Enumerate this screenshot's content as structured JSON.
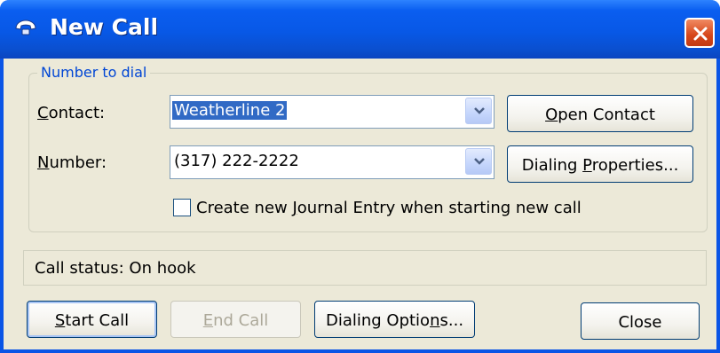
{
  "window": {
    "title": "New Call",
    "icon": "telephone-icon",
    "close_icon": "close-icon"
  },
  "number_group": {
    "legend": "Number to dial",
    "contact": {
      "label_u": "C",
      "label_rest": "ontact:",
      "value": "Weatherline 2",
      "selected": true
    },
    "number": {
      "label_u": "N",
      "label_rest": "umber:",
      "value": "(317) 222-2222"
    },
    "open_contact": {
      "u": "O",
      "rest": "pen Contact"
    },
    "dialing_properties": {
      "pre": "Dialing ",
      "u": "P",
      "rest": "roperties..."
    },
    "journal_checkbox": {
      "checked": false,
      "pre": "Create new ",
      "u": "J",
      "rest": "ournal Entry when starting new call"
    }
  },
  "status": {
    "text": "Call status:  On hook"
  },
  "buttons": {
    "start_call": {
      "u": "S",
      "rest": "tart Call"
    },
    "end_call": {
      "u": "E",
      "rest": "nd Call",
      "disabled": true
    },
    "dialing_options": {
      "pre": "Dialing Optio",
      "u": "n",
      "rest": "s..."
    },
    "close": {
      "label": "Close"
    }
  },
  "colors": {
    "titlebar": "#0858e6",
    "dialog_bg": "#ece9d8",
    "group_legend": "#0046d5",
    "selection": "#316ac5",
    "close_button": "#d6461a"
  }
}
